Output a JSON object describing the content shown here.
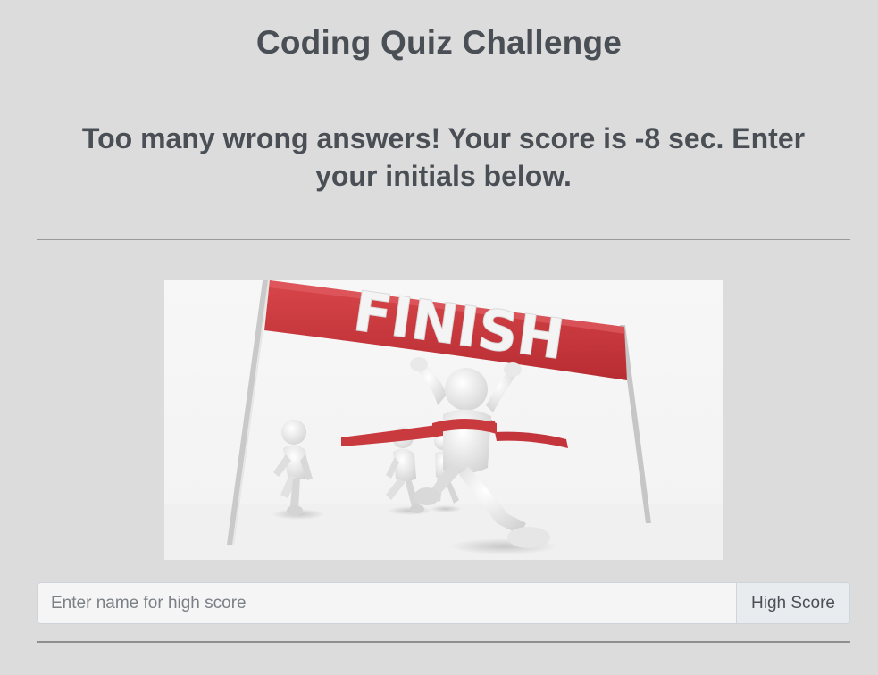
{
  "header": {
    "title": "Coding Quiz Challenge"
  },
  "result": {
    "message": "Too many wrong answers! Your score is -8 sec. Enter your initials below."
  },
  "image": {
    "banner_text": "FINISH",
    "banner_color": "#c9373c",
    "figure_color": "#ececec"
  },
  "high_score_form": {
    "input_placeholder": "Enter name for high score",
    "input_value": "",
    "button_label": "High Score"
  },
  "colors": {
    "background": "#dcdcdc",
    "text": "#4a4f55"
  }
}
